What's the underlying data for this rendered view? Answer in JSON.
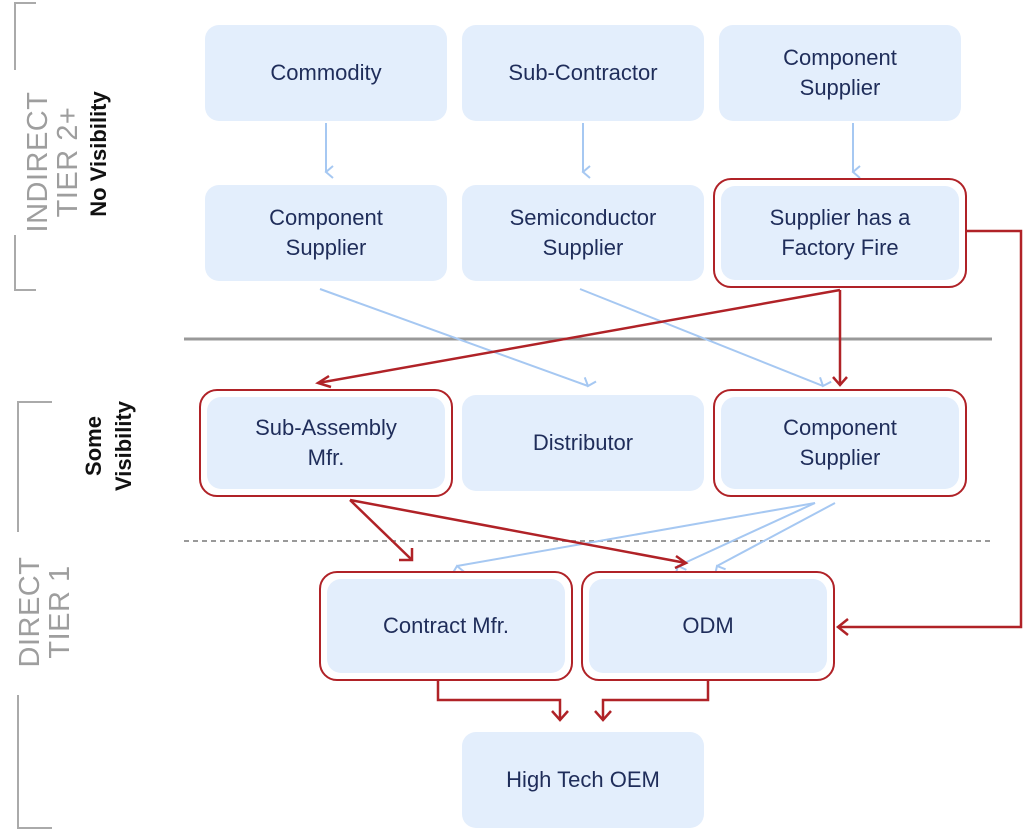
{
  "colors": {
    "node_fill": "#e3eefc",
    "node_text": "#1f2d5a",
    "highlight_red": "#b02227",
    "flow_blue": "#a6c8f2",
    "tier_gray": "#9e9e9e",
    "divider_gray": "#999999"
  },
  "tiers": {
    "indirect": "INDIRECT\nTIER 2+",
    "direct": "DIRECT\nTIER 1"
  },
  "visibility": {
    "none": "No Visibility",
    "some": "Some\nVisibility"
  },
  "nodes": {
    "commodity": "Commodity",
    "sub_contractor": "Sub-Contractor",
    "component_supplier_top": "Component\nSupplier",
    "component_supplier_t2": "Component\nSupplier",
    "semiconductor_supplier": "Semiconductor\nSupplier",
    "factory_fire": "Supplier has a\nFactory Fire",
    "sub_assembly": "Sub-Assembly\nMfr.",
    "distributor": "Distributor",
    "component_supplier_t1": "Component\nSupplier",
    "contract_mfr": "Contract Mfr.",
    "odm": "ODM",
    "oem": "High Tech OEM"
  },
  "edges": {
    "normal": [
      [
        "commodity",
        "component_supplier_t2"
      ],
      [
        "sub_contractor",
        "semiconductor_supplier"
      ],
      [
        "component_supplier_top",
        "factory_fire"
      ],
      [
        "component_supplier_t2",
        "distributor"
      ],
      [
        "semiconductor_supplier",
        "component_supplier_t1"
      ],
      [
        "component_supplier_t1",
        "contract_mfr"
      ],
      [
        "component_supplier_t1",
        "odm"
      ],
      [
        "component_supplier_t1",
        "odm"
      ]
    ],
    "disrupted": [
      [
        "factory_fire",
        "sub_assembly"
      ],
      [
        "factory_fire",
        "component_supplier_t1"
      ],
      [
        "factory_fire",
        "odm"
      ],
      [
        "sub_assembly",
        "contract_mfr"
      ],
      [
        "sub_assembly",
        "odm"
      ],
      [
        "contract_mfr",
        "oem"
      ],
      [
        "odm",
        "oem"
      ]
    ]
  }
}
